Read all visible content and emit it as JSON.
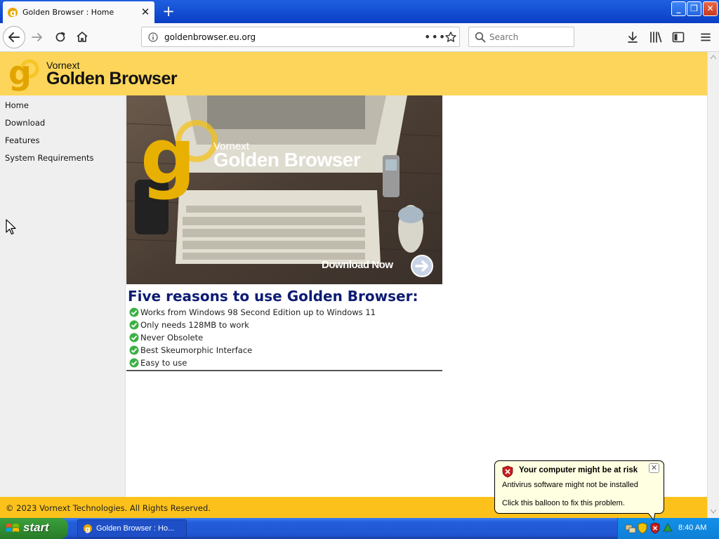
{
  "browser": {
    "tab_title": "Golden Browser : Home",
    "url": "goldenbrowser.eu.org",
    "search_placeholder": "Search"
  },
  "page": {
    "brand_small": "Vornext",
    "brand_big": "Golden Browser",
    "sidebar": [
      {
        "label": "Home"
      },
      {
        "label": "Download"
      },
      {
        "label": "Features"
      },
      {
        "label": "System Requirements"
      }
    ],
    "banner": {
      "brand_small": "Vornext",
      "brand_big": "Golden Browser",
      "cta": "Download Now"
    },
    "reasons_title": "Five reasons to use Golden Browser:",
    "reasons": [
      "Works from Windows 98 Second Edition up to Windows 11",
      "Only needs 128MB to work",
      "Never Obsolete",
      "Best Skeumorphic Interface",
      "Easy to use"
    ],
    "footer": "© 2023 Vornext Technologies. All Rights Reserved."
  },
  "balloon": {
    "title": "Your computer might be at risk",
    "line1": "Antivirus software might not be installed",
    "line2": "Click this balloon to fix this problem."
  },
  "taskbar": {
    "start": "start",
    "task_label": "Golden Browser : Ho...",
    "clock": "8:40 AM"
  },
  "colors": {
    "header": "#fdd55a",
    "footer": "#fcc21b",
    "title_blue": "#0c1c73",
    "check_green": "#3cb043"
  }
}
